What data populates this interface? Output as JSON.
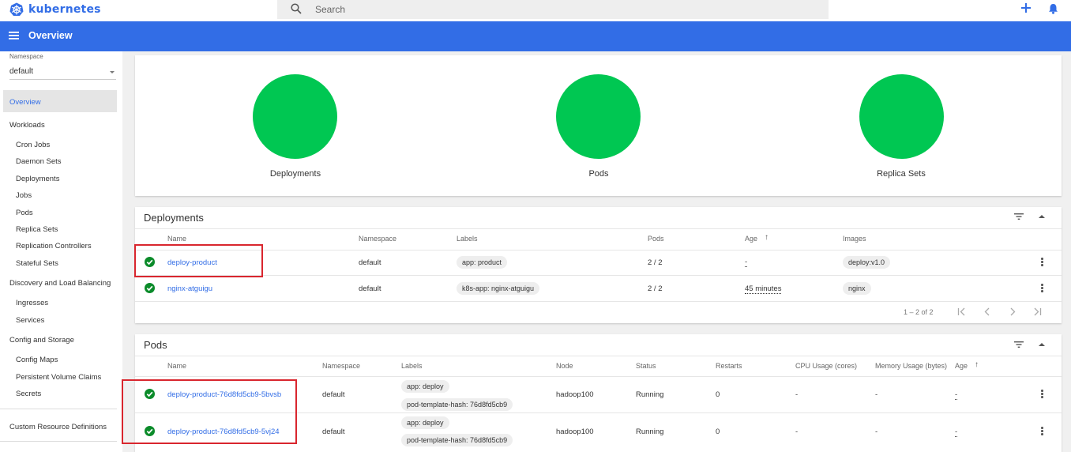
{
  "app": {
    "brand": "kubernetes",
    "page_title": "Overview"
  },
  "search": {
    "placeholder": "Search"
  },
  "sidebar": {
    "namespace_label": "Namespace",
    "namespace_value": "default",
    "overview": "Overview",
    "workloads": {
      "label": "Workloads",
      "items": [
        "Cron Jobs",
        "Daemon Sets",
        "Deployments",
        "Jobs",
        "Pods",
        "Replica Sets",
        "Replication Controllers",
        "Stateful Sets"
      ]
    },
    "discovery": {
      "label": "Discovery and Load Balancing",
      "items": [
        "Ingresses",
        "Services"
      ]
    },
    "config": {
      "label": "Config and Storage",
      "items": [
        "Config Maps",
        "Persistent Volume Claims",
        "Secrets"
      ]
    },
    "crd": "Custom Resource Definitions"
  },
  "status_summary": [
    {
      "label": "Deployments",
      "running_fraction": 1.0
    },
    {
      "label": "Pods",
      "running_fraction": 1.0
    },
    {
      "label": "Replica Sets",
      "running_fraction": 1.0
    }
  ],
  "deployments": {
    "title": "Deployments",
    "columns": [
      "Name",
      "Namespace",
      "Labels",
      "Pods",
      "Age",
      "Images"
    ],
    "age_sort_arrow": "↑",
    "rows": [
      {
        "name": "deploy-product",
        "namespace": "default",
        "labels": "app: product",
        "pods": "2 / 2",
        "age": "-",
        "image": "deploy:v1.0"
      },
      {
        "name": "nginx-atguigu",
        "namespace": "default",
        "labels": "k8s-app: nginx-atguigu",
        "pods": "2 / 2",
        "age": "45 minutes",
        "image": "nginx"
      }
    ],
    "pagination": "1 – 2 of 2"
  },
  "pods": {
    "title": "Pods",
    "columns": [
      "Name",
      "Namespace",
      "Labels",
      "Node",
      "Status",
      "Restarts",
      "CPU Usage (cores)",
      "Memory Usage (bytes)",
      "Age"
    ],
    "age_sort_arrow": "↑",
    "rows": [
      {
        "name": "deploy-product-76d8fd5cb9-5bvsb",
        "namespace": "default",
        "label1": "app: deploy",
        "label2": "pod-template-hash: 76d8fd5cb9",
        "node": "hadoop100",
        "status": "Running",
        "restarts": "0",
        "cpu": "-",
        "memory": "-",
        "age": "-"
      },
      {
        "name": "deploy-product-76d8fd5cb9-5vj24",
        "namespace": "default",
        "label1": "app: deploy",
        "label2": "pod-template-hash: 76d8fd5cb9",
        "node": "hadoop100",
        "status": "Running",
        "restarts": "0",
        "cpu": "-",
        "memory": "-",
        "age": "-"
      }
    ]
  },
  "colors": {
    "brand": "#326de6",
    "success": "#00c752",
    "highlight": "#d9262e"
  }
}
